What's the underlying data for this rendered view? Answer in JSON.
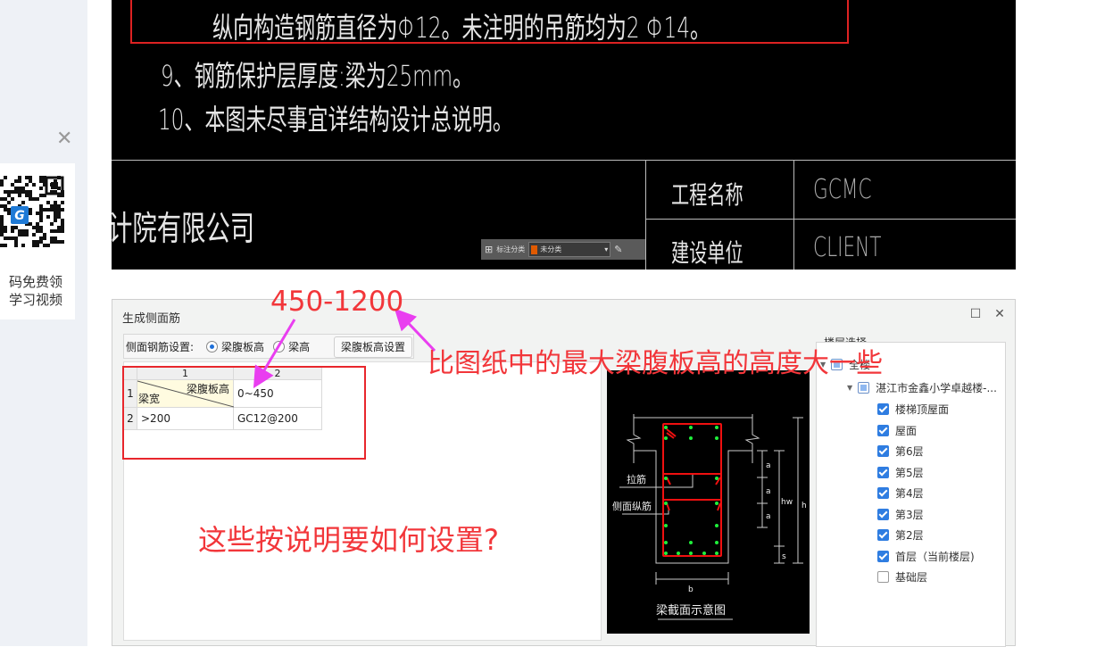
{
  "sidebar": {
    "close_icon": "close-icon",
    "qr_caption_1": "码免费领",
    "qr_caption_2": "学习视频"
  },
  "cad": {
    "line_note": "纵向构造钢筋直径为Φ12。未注明的吊筋均为2 Φ14。",
    "line_9": "9、钢筋保护层厚度:梁为25mm。",
    "line_10": "10、本图未尽事宜详结构设计总说明。",
    "company": "计院有限公司",
    "project_label": "工程名称",
    "project_value": "GCMC",
    "client_label": "建设单位",
    "client_value": "CLIENT",
    "toolbar": {
      "label": "标注分类",
      "select_value": "未分类",
      "select_color": "#e05a00"
    }
  },
  "dialog": {
    "title": "生成侧面筋",
    "setting_label": "侧面钢筋设置:",
    "radio_options": [
      {
        "label": "梁腹板高",
        "checked": true
      },
      {
        "label": "梁高",
        "checked": false
      }
    ],
    "settings_button": "梁腹板高设置",
    "table": {
      "col_headers": [
        "1",
        "2"
      ],
      "row_headers": [
        "1",
        "2"
      ],
      "corner_top": "梁腹板高",
      "corner_bottom": "梁宽",
      "rows": [
        [
          "0~450"
        ],
        [
          ">200",
          "GC12@200"
        ]
      ]
    },
    "diagram": {
      "tie_label": "拉筋",
      "side_bar_label": "侧面纵筋",
      "dim_a": "a",
      "dim_hw": "hw",
      "dim_h": "h",
      "dim_s": "s",
      "dim_b": "b",
      "title": "梁截面示意图"
    },
    "floor_panel": {
      "title": "楼层选择",
      "root": {
        "label": "全楼",
        "state": "partial"
      },
      "project": {
        "label": "湛江市金鑫小学卓越楼-...",
        "state": "partial"
      },
      "floors": [
        {
          "label": "楼梯顶屋面",
          "checked": true
        },
        {
          "label": "屋面",
          "checked": true
        },
        {
          "label": "第6层",
          "checked": true
        },
        {
          "label": "第5层",
          "checked": true
        },
        {
          "label": "第4层",
          "checked": true
        },
        {
          "label": "第3层",
          "checked": true
        },
        {
          "label": "第2层",
          "checked": true
        },
        {
          "label": "首层（当前楼层)",
          "checked": true
        },
        {
          "label": "基础层",
          "checked": false
        }
      ]
    }
  },
  "annotations": {
    "range": "450-1200",
    "hint": "比图纸中的最大梁腹板高的高度大一些",
    "question": "这些按说明要如何设置?",
    "text_color": "#f2363a",
    "arrow_color": "#e93ef0"
  }
}
